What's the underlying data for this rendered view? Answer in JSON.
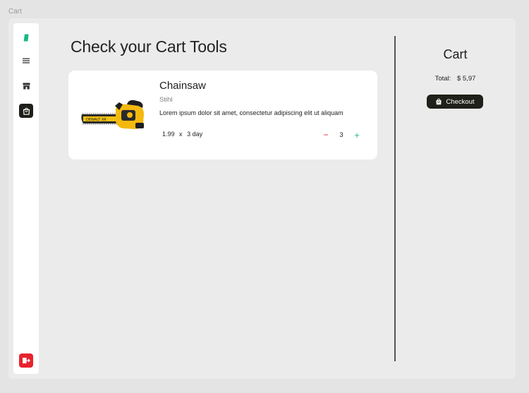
{
  "frame": {
    "label": "Cart"
  },
  "sidebar": {
    "items": [
      {
        "name": "tag-icon",
        "color": "#17b887"
      },
      {
        "name": "menu-icon",
        "color": "#333333"
      },
      {
        "name": "store-icon",
        "color": "#333333"
      },
      {
        "name": "shopping-bag-icon",
        "color": "#ffffff",
        "active": true
      }
    ],
    "logout_icon": "logout-icon"
  },
  "main": {
    "title": "Check your Cart Tools",
    "items": [
      {
        "name": "Chainsaw",
        "brand": "Stihl",
        "description": "Lorem ipsum dolor sit amet, consectetur adipiscing elit ut aliquam",
        "price": "1.99",
        "times": "x",
        "duration": "3 day",
        "quantity": "3",
        "minus": "−",
        "plus": "+"
      }
    ]
  },
  "summary": {
    "title": "Cart",
    "total_label": "Total:",
    "total_value": "$ 5,97",
    "checkout_label": "Checkout"
  },
  "colors": {
    "accent": "#17b887",
    "danger": "#e6232e",
    "dark": "#1e2019"
  }
}
